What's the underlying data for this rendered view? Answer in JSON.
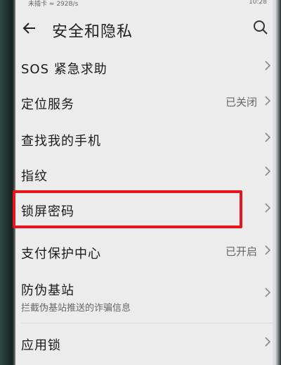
{
  "status_bar": {
    "carrier": "未插卡",
    "speed": "292B/s",
    "time": "10:28"
  },
  "header": {
    "title": "安全和隐私"
  },
  "items": [
    {
      "label": "SOS 紧急求助",
      "value": "",
      "subtitle": ""
    },
    {
      "label": "定位服务",
      "value": "已关闭",
      "subtitle": ""
    },
    {
      "label": "查找我的手机",
      "value": "",
      "subtitle": ""
    },
    {
      "label": "指纹",
      "value": "",
      "subtitle": ""
    },
    {
      "label": "锁屏密码",
      "value": "",
      "subtitle": ""
    },
    {
      "label": "支付保护中心",
      "value": "已开启",
      "subtitle": ""
    },
    {
      "label": "防伪基站",
      "value": "",
      "subtitle": "拦截伪基站推送的诈骗信息"
    },
    {
      "label": "应用锁",
      "value": "",
      "subtitle": ""
    }
  ],
  "colors": {
    "highlight": "#e8161c",
    "background": "#ececec"
  }
}
